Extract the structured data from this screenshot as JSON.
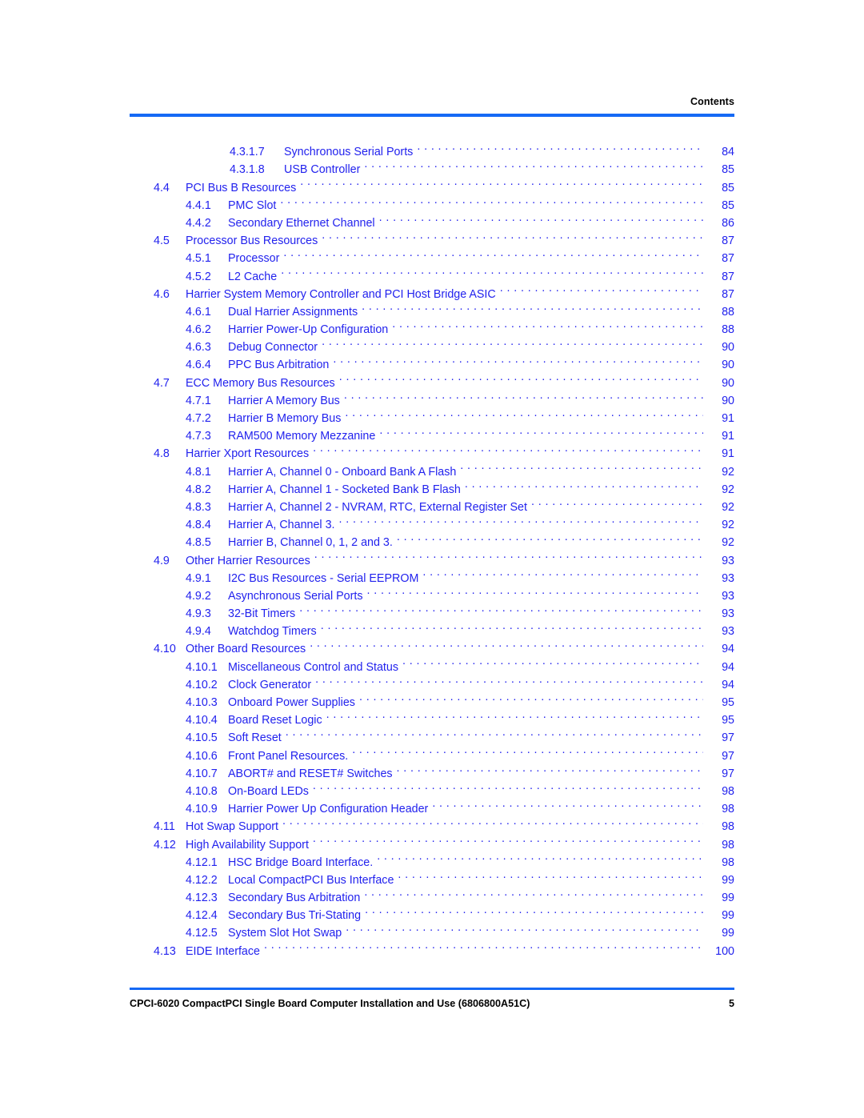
{
  "header": {
    "title": "Contents",
    "rule_color": "#1569f5"
  },
  "colors": {
    "entry_text": "#2222ee",
    "rule": "#1569f5",
    "header_text": "#000000",
    "footer_text": "#000000"
  },
  "toc": {
    "entries": [
      {
        "level": 4,
        "number": "4.3.1.7",
        "title": "Synchronous Serial Ports",
        "page": "84"
      },
      {
        "level": 4,
        "number": "4.3.1.8",
        "title": "USB Controller",
        "page": "85"
      },
      {
        "level": 2,
        "number": "4.4",
        "title": "PCI Bus B Resources",
        "page": "85"
      },
      {
        "level": 3,
        "number": "4.4.1",
        "title": "PMC Slot",
        "page": "85"
      },
      {
        "level": 3,
        "number": "4.4.2",
        "title": "Secondary Ethernet Channel",
        "page": "86"
      },
      {
        "level": 2,
        "number": "4.5",
        "title": "Processor Bus Resources",
        "page": "87"
      },
      {
        "level": 3,
        "number": "4.5.1",
        "title": "Processor",
        "page": "87"
      },
      {
        "level": 3,
        "number": "4.5.2",
        "title": "L2 Cache",
        "page": "87"
      },
      {
        "level": 2,
        "number": "4.6",
        "title": "Harrier System Memory Controller and PCI Host Bridge ASIC",
        "page": "87"
      },
      {
        "level": 3,
        "number": "4.6.1",
        "title": "Dual Harrier Assignments",
        "page": "88"
      },
      {
        "level": 3,
        "number": "4.6.2",
        "title": "Harrier Power-Up Configuration",
        "page": "88"
      },
      {
        "level": 3,
        "number": "4.6.3",
        "title": "Debug Connector",
        "page": "90"
      },
      {
        "level": 3,
        "number": "4.6.4",
        "title": "PPC Bus Arbitration",
        "page": "90"
      },
      {
        "level": 2,
        "number": "4.7",
        "title": "ECC Memory Bus Resources",
        "page": "90"
      },
      {
        "level": 3,
        "number": "4.7.1",
        "title": "Harrier A Memory Bus",
        "page": "90"
      },
      {
        "level": 3,
        "number": "4.7.2",
        "title": "Harrier B Memory Bus",
        "page": "91"
      },
      {
        "level": 3,
        "number": "4.7.3",
        "title": "RAM500 Memory Mezzanine",
        "page": "91"
      },
      {
        "level": 2,
        "number": "4.8",
        "title": "Harrier Xport Resources",
        "page": "91"
      },
      {
        "level": 3,
        "number": "4.8.1",
        "title": "Harrier A, Channel 0 - Onboard Bank A Flash",
        "page": "92"
      },
      {
        "level": 3,
        "number": "4.8.2",
        "title": "Harrier A, Channel 1 - Socketed Bank B Flash",
        "page": "92"
      },
      {
        "level": 3,
        "number": "4.8.3",
        "title": "Harrier A, Channel 2 - NVRAM, RTC, External Register Set",
        "page": "92"
      },
      {
        "level": 3,
        "number": "4.8.4",
        "title": "Harrier A, Channel 3.",
        "page": "92"
      },
      {
        "level": 3,
        "number": "4.8.5",
        "title": "Harrier B, Channel 0, 1, 2 and 3.",
        "page": "92"
      },
      {
        "level": 2,
        "number": "4.9",
        "title": "Other Harrier Resources",
        "page": "93"
      },
      {
        "level": 3,
        "number": "4.9.1",
        "title": "I2C Bus Resources - Serial EEPROM",
        "page": "93"
      },
      {
        "level": 3,
        "number": "4.9.2",
        "title": "Asynchronous Serial Ports",
        "page": "93"
      },
      {
        "level": 3,
        "number": "4.9.3",
        "title": "32-Bit Timers",
        "page": "93"
      },
      {
        "level": 3,
        "number": "4.9.4",
        "title": "Watchdog Timers",
        "page": "93"
      },
      {
        "level": 2,
        "number": "4.10",
        "title": "Other Board Resources",
        "page": "94"
      },
      {
        "level": 3,
        "number": "4.10.1",
        "title": "Miscellaneous Control and Status",
        "page": "94"
      },
      {
        "level": 3,
        "number": "4.10.2",
        "title": "Clock Generator",
        "page": "94"
      },
      {
        "level": 3,
        "number": "4.10.3",
        "title": "Onboard Power Supplies",
        "page": "95"
      },
      {
        "level": 3,
        "number": "4.10.4",
        "title": "Board Reset Logic",
        "page": "95"
      },
      {
        "level": 3,
        "number": "4.10.5",
        "title": "Soft Reset",
        "page": "97"
      },
      {
        "level": 3,
        "number": "4.10.6",
        "title": "Front Panel Resources.",
        "page": "97"
      },
      {
        "level": 3,
        "number": "4.10.7",
        "title": "ABORT# and RESET# Switches",
        "page": "97"
      },
      {
        "level": 3,
        "number": "4.10.8",
        "title": "On-Board LEDs",
        "page": "98"
      },
      {
        "level": 3,
        "number": "4.10.9",
        "title": "Harrier Power Up Configuration Header",
        "page": "98"
      },
      {
        "level": 2,
        "number": "4.11",
        "title": "Hot Swap Support",
        "page": "98"
      },
      {
        "level": 2,
        "number": "4.12",
        "title": "High Availability Support",
        "page": "98"
      },
      {
        "level": 3,
        "number": "4.12.1",
        "title": "HSC Bridge Board Interface.",
        "page": "98"
      },
      {
        "level": 3,
        "number": "4.12.2",
        "title": "Local CompactPCI Bus Interface",
        "page": "99"
      },
      {
        "level": 3,
        "number": "4.12.3",
        "title": "Secondary Bus Arbitration",
        "page": "99"
      },
      {
        "level": 3,
        "number": "4.12.4",
        "title": "Secondary Bus Tri-Stating",
        "page": "99"
      },
      {
        "level": 3,
        "number": "4.12.5",
        "title": "System Slot Hot Swap",
        "page": "99"
      },
      {
        "level": 2,
        "number": "4.13",
        "title": "EIDE Interface",
        "page": "100"
      }
    ]
  },
  "footer": {
    "text": "CPCI-6020 CompactPCI Single Board Computer Installation and Use (6806800A51C)",
    "page": "5",
    "rule_color": "#1569f5"
  }
}
